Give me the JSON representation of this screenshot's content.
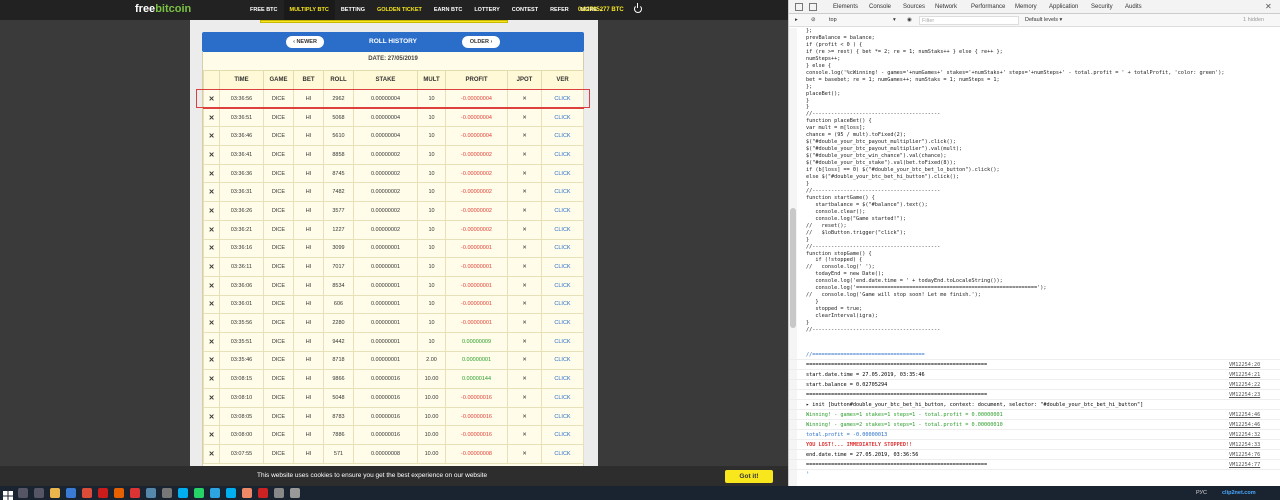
{
  "site": {
    "logo_free": "free",
    "logo_bitcoin": "bitcoin",
    "nav": [
      "FREE BTC",
      "MULTIPLY BTC",
      "BETTING",
      "GOLDEN TICKET",
      "EARN BTC",
      "LOTTERY",
      "CONTEST",
      "REFER",
      "MORE ⌄"
    ],
    "balance": "0.02705277 BTC",
    "roll_history_title": "ROLL HISTORY",
    "newer_label": "‹ NEWER",
    "older_label": "OLDER ›",
    "date_label": "DATE: 27/05/2019",
    "columns": [
      "",
      "TIME",
      "GAME",
      "BET",
      "ROLL",
      "STAKE",
      "MULT",
      "PROFIT",
      "JPOT",
      "VER"
    ],
    "rows": [
      {
        "time": "03:36:56",
        "game": "DICE",
        "bet": "HI",
        "roll": "2962",
        "stake": "0.00000004",
        "mult": "10",
        "profit": "-0.00000004",
        "sign": "neg",
        "jpot": "✕",
        "ver": "CLICK"
      },
      {
        "time": "03:36:51",
        "game": "DICE",
        "bet": "HI",
        "roll": "5068",
        "stake": "0.00000004",
        "mult": "10",
        "profit": "-0.00000004",
        "sign": "neg",
        "jpot": "✕",
        "ver": "CLICK"
      },
      {
        "time": "03:36:46",
        "game": "DICE",
        "bet": "HI",
        "roll": "5610",
        "stake": "0.00000004",
        "mult": "10",
        "profit": "-0.00000004",
        "sign": "neg",
        "jpot": "✕",
        "ver": "CLICK"
      },
      {
        "time": "03:36:41",
        "game": "DICE",
        "bet": "HI",
        "roll": "8858",
        "stake": "0.00000002",
        "mult": "10",
        "profit": "-0.00000002",
        "sign": "neg",
        "jpot": "✕",
        "ver": "CLICK"
      },
      {
        "time": "03:36:36",
        "game": "DICE",
        "bet": "HI",
        "roll": "8745",
        "stake": "0.00000002",
        "mult": "10",
        "profit": "-0.00000002",
        "sign": "neg",
        "jpot": "✕",
        "ver": "CLICK"
      },
      {
        "time": "03:36:31",
        "game": "DICE",
        "bet": "HI",
        "roll": "7482",
        "stake": "0.00000002",
        "mult": "10",
        "profit": "-0.00000002",
        "sign": "neg",
        "jpot": "✕",
        "ver": "CLICK"
      },
      {
        "time": "03:36:26",
        "game": "DICE",
        "bet": "HI",
        "roll": "3577",
        "stake": "0.00000002",
        "mult": "10",
        "profit": "-0.00000002",
        "sign": "neg",
        "jpot": "✕",
        "ver": "CLICK"
      },
      {
        "time": "03:36:21",
        "game": "DICE",
        "bet": "HI",
        "roll": "1227",
        "stake": "0.00000002",
        "mult": "10",
        "profit": "-0.00000002",
        "sign": "neg",
        "jpot": "✕",
        "ver": "CLICK"
      },
      {
        "time": "03:36:16",
        "game": "DICE",
        "bet": "HI",
        "roll": "3099",
        "stake": "0.00000001",
        "mult": "10",
        "profit": "-0.00000001",
        "sign": "neg",
        "jpot": "✕",
        "ver": "CLICK"
      },
      {
        "time": "03:36:11",
        "game": "DICE",
        "bet": "HI",
        "roll": "7017",
        "stake": "0.00000001",
        "mult": "10",
        "profit": "-0.00000001",
        "sign": "neg",
        "jpot": "✕",
        "ver": "CLICK"
      },
      {
        "time": "03:36:06",
        "game": "DICE",
        "bet": "HI",
        "roll": "8534",
        "stake": "0.00000001",
        "mult": "10",
        "profit": "-0.00000001",
        "sign": "neg",
        "jpot": "✕",
        "ver": "CLICK"
      },
      {
        "time": "03:36:01",
        "game": "DICE",
        "bet": "HI",
        "roll": "606",
        "stake": "0.00000001",
        "mult": "10",
        "profit": "-0.00000001",
        "sign": "neg",
        "jpot": "✕",
        "ver": "CLICK"
      },
      {
        "time": "03:35:56",
        "game": "DICE",
        "bet": "HI",
        "roll": "2280",
        "stake": "0.00000001",
        "mult": "10",
        "profit": "-0.00000001",
        "sign": "neg",
        "jpot": "✕",
        "ver": "CLICK"
      },
      {
        "time": "03:35:51",
        "game": "DICE",
        "bet": "HI",
        "roll": "9442",
        "stake": "0.00000001",
        "mult": "10",
        "profit": "0.00000009",
        "sign": "pos",
        "jpot": "✕",
        "ver": "CLICK"
      },
      {
        "time": "03:35:46",
        "game": "DICE",
        "bet": "HI",
        "roll": "8718",
        "stake": "0.00000001",
        "mult": "2.00",
        "profit": "0.00000001",
        "sign": "pos",
        "jpot": "✕",
        "ver": "CLICK"
      },
      {
        "time": "03:08:15",
        "game": "DICE",
        "bet": "HI",
        "roll": "9866",
        "stake": "0.00000016",
        "mult": "10.00",
        "profit": "0.00000144",
        "sign": "pos",
        "jpot": "✕",
        "ver": "CLICK"
      },
      {
        "time": "03:08:10",
        "game": "DICE",
        "bet": "HI",
        "roll": "5048",
        "stake": "0.00000016",
        "mult": "10.00",
        "profit": "-0.00000016",
        "sign": "neg",
        "jpot": "✕",
        "ver": "CLICK"
      },
      {
        "time": "03:08:05",
        "game": "DICE",
        "bet": "HI",
        "roll": "8783",
        "stake": "0.00000016",
        "mult": "10.00",
        "profit": "-0.00000016",
        "sign": "neg",
        "jpot": "✕",
        "ver": "CLICK"
      },
      {
        "time": "03:08:00",
        "game": "DICE",
        "bet": "HI",
        "roll": "7886",
        "stake": "0.00000016",
        "mult": "10.00",
        "profit": "-0.00000016",
        "sign": "neg",
        "jpot": "✕",
        "ver": "CLICK"
      },
      {
        "time": "03:07:55",
        "game": "DICE",
        "bet": "HI",
        "roll": "571",
        "stake": "0.00000008",
        "mult": "10.00",
        "profit": "-0.00000008",
        "sign": "neg",
        "jpot": "✕",
        "ver": "CLICK"
      }
    ],
    "cookie_text": "This website uses cookies to ensure you get the best experience on our website",
    "cookie_button": "Got it!"
  },
  "devtools": {
    "tabs": [
      "Elements",
      "Console",
      "Sources",
      "Network",
      "Performance",
      "Memory",
      "Application",
      "Security",
      "Audits"
    ],
    "active_tab": "Console",
    "context": "top",
    "filter_placeholder": "Filter",
    "levels": "Default levels ▾",
    "hidden": "1 hidden",
    "code": "};\nprevBalance = balance;\nif (profit < 0 ) {\nif (re >= rest) { bet *= 2; re = 1; numStaks++ } else { re++ };\nnumSteps++;\n} else {\nconsole.log('%cWinning! - games='+numGames+' stakes='+numStaks+' steps='+numSteps+' - total.profit = ' + totalProfit, 'color: green');\nbet = basebet; re = 1; numGames++; numStaks = 1; numSteps = 1;\n};\nplaceBet();\n}\n}\n//-----------------------------------------\nfunction placeBet() {\nvar mult = m[loss];\nchance = (95 / mult).toFixed(2);\n$(\"#double_your_btc_payout_multiplier\").click();\n$(\"#double_your_btc_payout_multiplier\").val(mult);\n$(\"#double_your_btc_win_chance\").val(chance);\n$(\"#double_your_btc_stake\").val(bet.toFixed(8));\nif (b[loss] == 0) $(\"#double_your_btc_bet_lo_button\").click();\nelse $(\"#double_your_btc_bet_hi_button\").click();\n}\n//-----------------------------------------\nfunction startGame() {\n   startbalance = $(\"#balance\").text();\n   console.clear();\n   console.log(\"Game started!\");\n//   reset();\n//   $loButton.trigger(\"click\");\n}\n//-----------------------------------------\nfunction stopGame() {\n   if (!stopped) {\n//   console.log(' ');\n   todayEnd = new Date();\n   console.log('end.date.time = ' + todayEnd.toLocaleString());\n   console.log('==========================================================');\n//   console.log('Game will stop soon! Let me finish.');\n   }\n   stopped = true;\n   clearInterval(igra);\n}\n//-----------------------------------------",
    "logs": [
      {
        "msg": "//====================================",
        "src": "",
        "style": "blue"
      },
      {
        "msg": "==========================================================",
        "src": "VM12254:20",
        "style": ""
      },
      {
        "msg": "start.date.time = 27.05.2019, 03:35:46",
        "src": "VM12254:21",
        "style": ""
      },
      {
        "msg": "start.balance = 0.02705294",
        "src": "VM12254:22",
        "style": ""
      },
      {
        "msg": "==========================================================",
        "src": "VM12254:23",
        "style": ""
      },
      {
        "msg": "▸ init [button#double_your_btc_bet_hi_button, context: document, selector: \"#double_your_btc_bet_hi_button\"]",
        "src": "",
        "style": ""
      },
      {
        "msg": "Winning! - games=1 stakes=1 steps=1 - total.profit = 0.00000001",
        "src": "VM12254:46",
        "style": "green"
      },
      {
        "msg": "Winning! - games=2 stakes=1 steps=1 - total.profit = 0.00000010",
        "src": "VM12254:46",
        "style": "green"
      },
      {
        "msg": "total.profit = -0.00000013",
        "src": "VM12254:32",
        "style": "blue"
      },
      {
        "msg": "YOU LOST!... IMMEDIATELY STOPPED!!",
        "src": "VM12254:33",
        "style": "red"
      },
      {
        "msg": "end.date.time = 27.05.2019, 03:36:56",
        "src": "VM12254:76",
        "style": ""
      },
      {
        "msg": "==========================================================",
        "src": "VM12254:77",
        "style": ""
      }
    ]
  },
  "taskbar": {
    "lang": "РУС",
    "brand": "clip2net.com"
  }
}
